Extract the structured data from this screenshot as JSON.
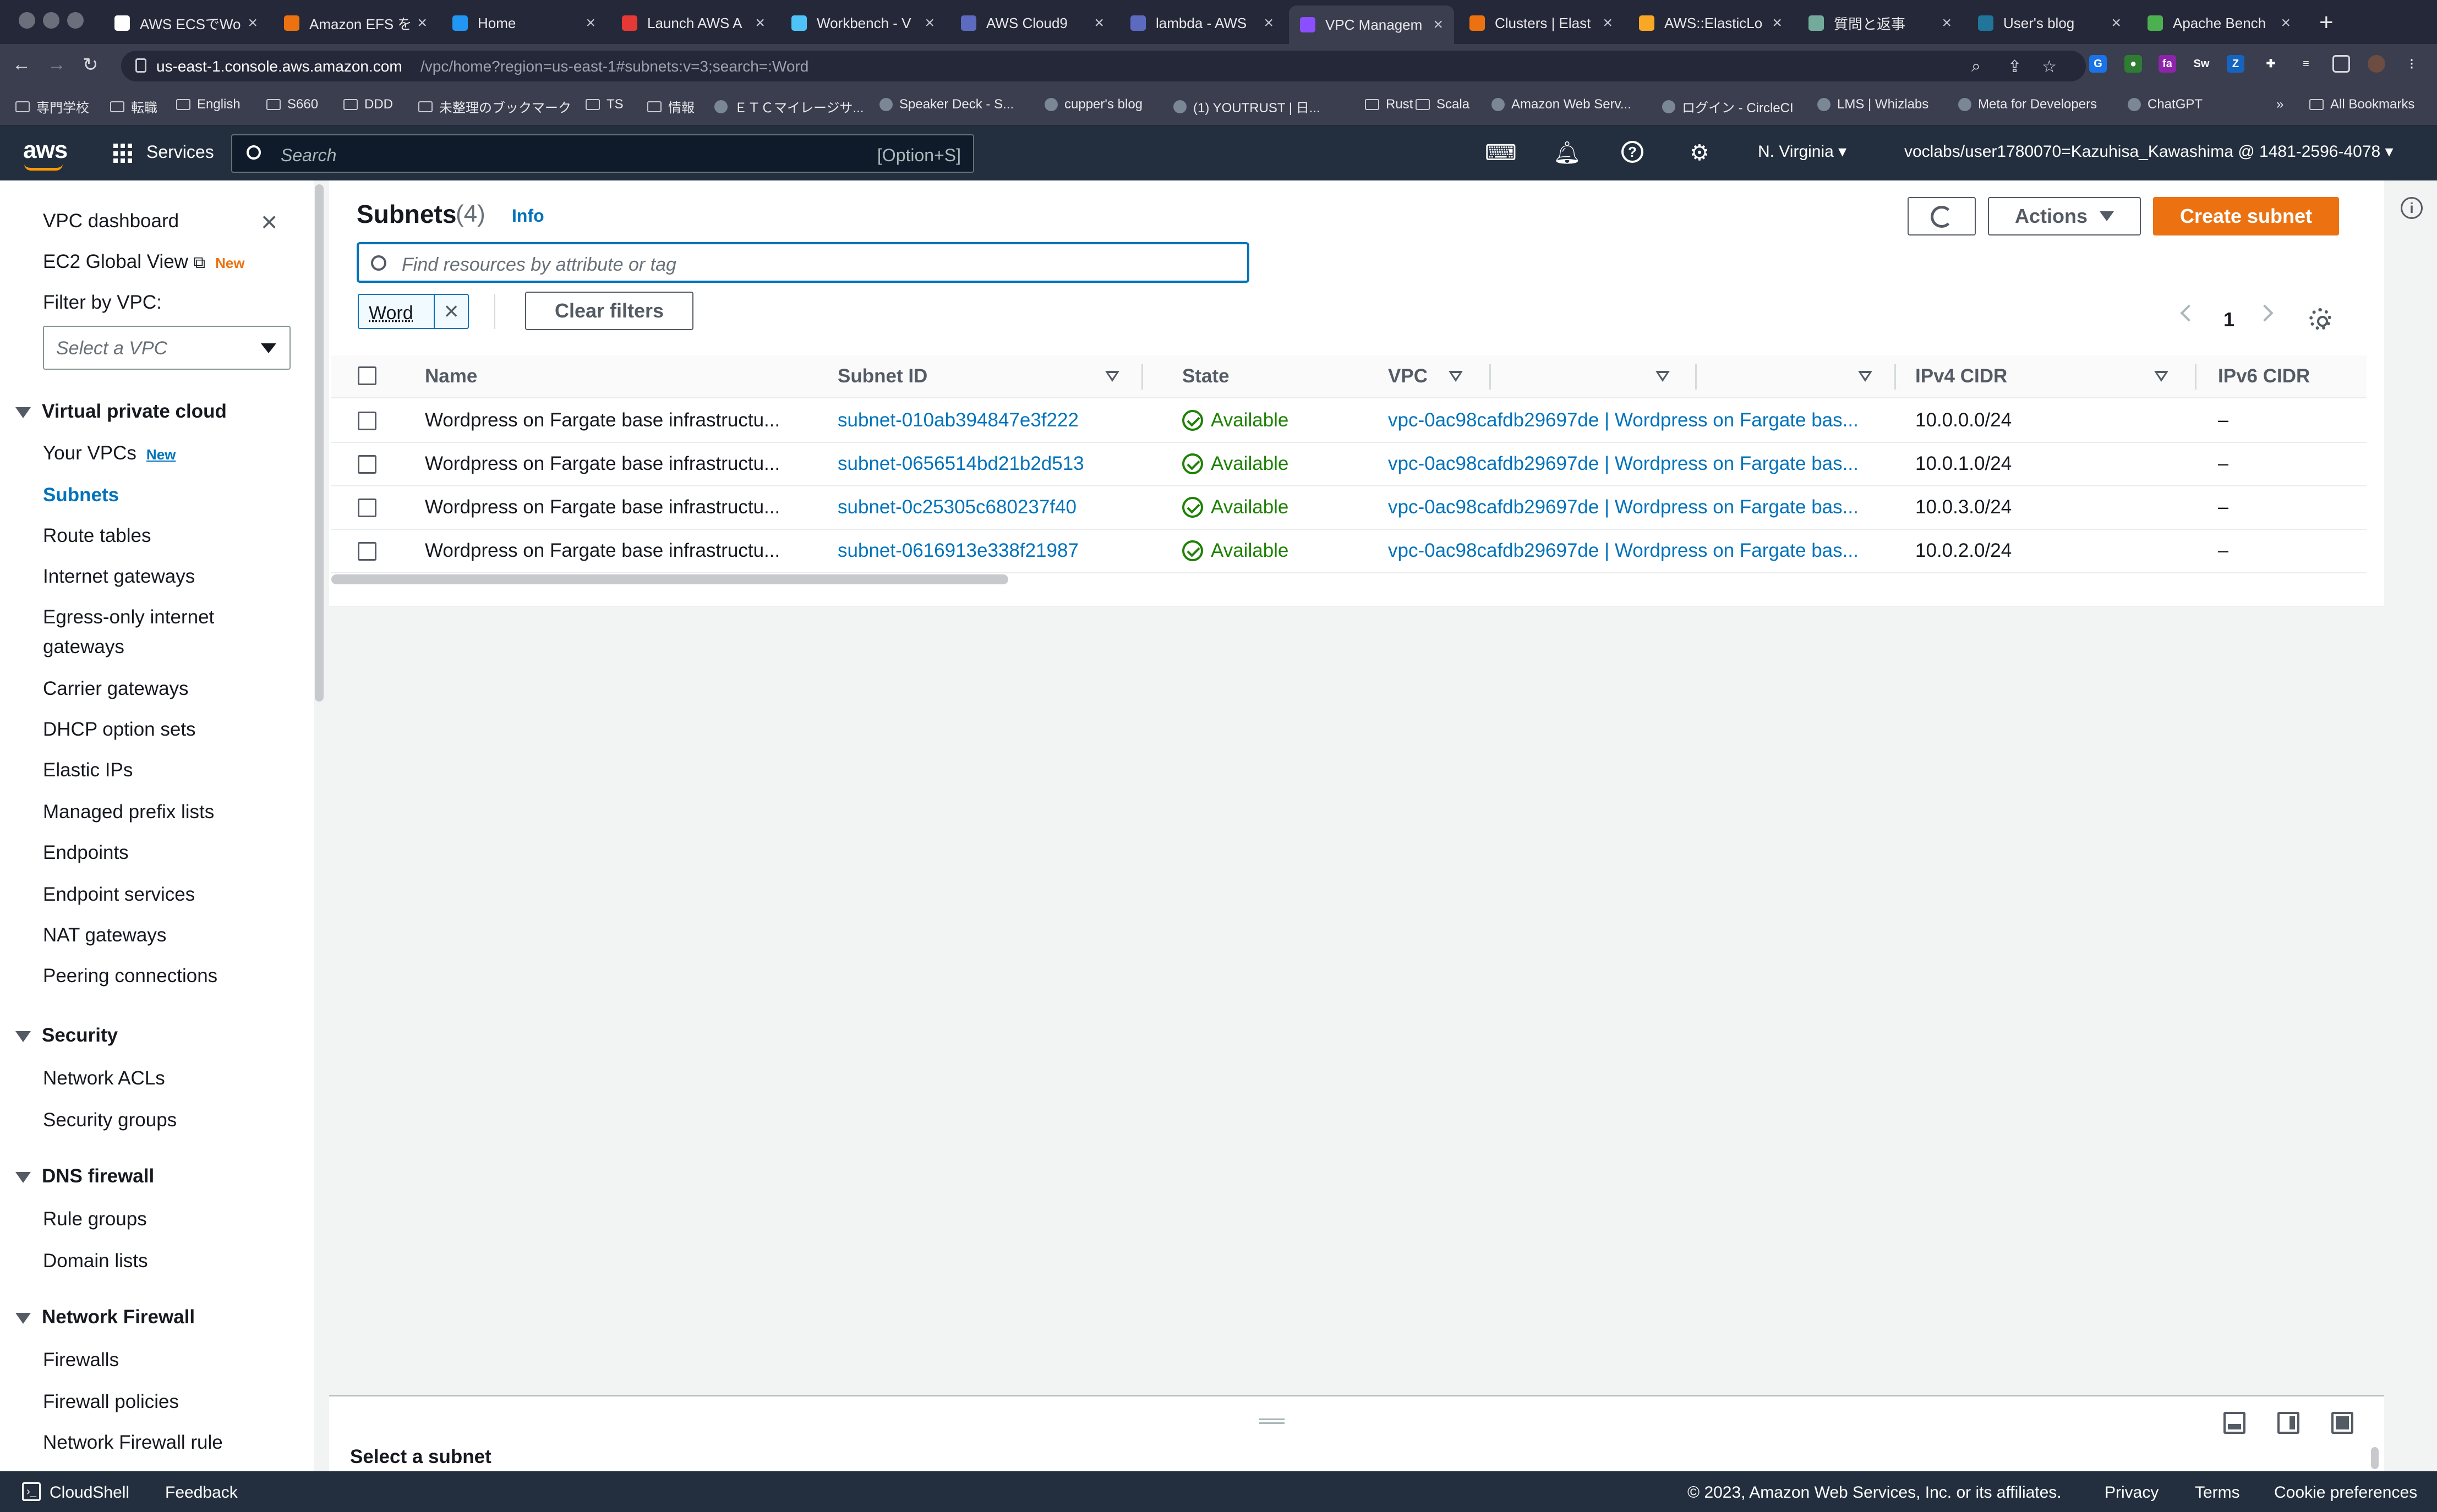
{
  "browser": {
    "tabs": [
      {
        "label": "AWS ECSでWo",
        "icon_color": "#ffffff"
      },
      {
        "label": "Amazon EFS を",
        "icon_color": "#ec7211"
      },
      {
        "label": "Home",
        "icon_color": "#2196f3"
      },
      {
        "label": "Launch AWS A",
        "icon_color": "#e53935"
      },
      {
        "label": "Workbench - V",
        "icon_color": "#4fc3f7"
      },
      {
        "label": "AWS Cloud9",
        "icon_color": "#5c6bc0"
      },
      {
        "label": "lambda - AWS",
        "icon_color": "#5c6bc0"
      },
      {
        "label": "VPC Managem",
        "icon_color": "#8c4fff"
      },
      {
        "label": "Clusters | Elast",
        "icon_color": "#ec7211"
      },
      {
        "label": "AWS::ElasticLo",
        "icon_color": "#f9a825"
      },
      {
        "label": "質問と返事",
        "icon_color": "#74aa9c"
      },
      {
        "label": "User's blog",
        "icon_color": "#21759b"
      },
      {
        "label": "Apache Bench",
        "icon_color": "#4caf50"
      }
    ],
    "url_host": "us-east-1.console.aws.amazon.com",
    "url_path": "/vpc/home?region=us-east-1#subnets:v=3;search=:Word",
    "bookmarks": [
      {
        "label": "専門学校",
        "icon": "folder-icon"
      },
      {
        "label": "転職",
        "icon": "folder-icon"
      },
      {
        "label": "English",
        "icon": "folder-icon"
      },
      {
        "label": "S660",
        "icon": "folder-icon"
      },
      {
        "label": "DDD",
        "icon": "folder-icon"
      },
      {
        "label": "未整理のブックマーク",
        "icon": "folder-icon"
      },
      {
        "label": "TS",
        "icon": "folder-icon"
      },
      {
        "label": "情報",
        "icon": "folder-icon"
      },
      {
        "label": "ＥＴＣマイレージサ...",
        "icon": "site-icon"
      },
      {
        "label": "Speaker Deck - S...",
        "icon": "site-icon"
      },
      {
        "label": "cupper's blog",
        "icon": "site-icon"
      },
      {
        "label": "(1) YOUTRUST | 日...",
        "icon": "site-icon"
      },
      {
        "label": "Rust",
        "icon": "folder-icon"
      },
      {
        "label": "Scala",
        "icon": "folder-icon"
      },
      {
        "label": "Amazon Web Serv...",
        "icon": "site-icon"
      },
      {
        "label": "ログイン - CircleCI",
        "icon": "site-icon"
      },
      {
        "label": "LMS | Whizlabs",
        "icon": "site-icon"
      },
      {
        "label": "Meta for Developers",
        "icon": "site-icon"
      },
      {
        "label": "ChatGPT",
        "icon": "site-icon"
      }
    ],
    "more_bookmarks": "»",
    "all_bookmarks": "All Bookmarks"
  },
  "aws_header": {
    "logo": "aws",
    "services": "Services",
    "search_placeholder": "Search",
    "search_shortcut": "[Option+S]",
    "region": "N. Virginia",
    "account": "voclabs/user1780070=Kazuhisa_Kawashima @ 1481-2596-4078"
  },
  "sidebar": {
    "top_items": [
      "VPC dashboard",
      "EC2 Global View"
    ],
    "new_badge": "New",
    "filter_label": "Filter by VPC:",
    "vpc_select_placeholder": "Select a VPC",
    "sections": [
      {
        "title": "Virtual private cloud",
        "items": [
          "Your VPCs",
          "Subnets",
          "Route tables",
          "Internet gateways",
          "Egress-only internet",
          "gateways",
          "Carrier gateways",
          "DHCP option sets",
          "Elastic IPs",
          "Managed prefix lists",
          "Endpoints",
          "Endpoint services",
          "NAT gateways",
          "Peering connections"
        ]
      },
      {
        "title": "Security",
        "items": [
          "Network ACLs",
          "Security groups"
        ]
      },
      {
        "title": "DNS firewall",
        "items": [
          "Rule groups",
          "Domain lists"
        ]
      },
      {
        "title": "Network Firewall",
        "items": [
          "Firewalls",
          "Firewall policies",
          "Network Firewall rule"
        ]
      }
    ]
  },
  "main": {
    "title": "Subnets",
    "count": "(4)",
    "info": "Info",
    "actions": "Actions",
    "create": "Create subnet",
    "filter_placeholder": "Find resources by attribute or tag",
    "filter_token": "Word",
    "clear_filters": "Clear filters",
    "page": "1",
    "columns": [
      "Name",
      "Subnet ID",
      "State",
      "VPC",
      "IPv4 CIDR",
      "IPv6 CIDR"
    ],
    "rows": [
      {
        "name": "Wordpress on Fargate base infrastructu...",
        "subnet_id": "subnet-010ab394847e3f222",
        "state": "Available",
        "vpc": "vpc-0ac98cafdb29697de | Wordpress on Fargate bas...",
        "ipv4": "10.0.0.0/24",
        "ipv6": "–"
      },
      {
        "name": "Wordpress on Fargate base infrastructu...",
        "subnet_id": "subnet-0656514bd21b2d513",
        "state": "Available",
        "vpc": "vpc-0ac98cafdb29697de | Wordpress on Fargate bas...",
        "ipv4": "10.0.1.0/24",
        "ipv6": "–"
      },
      {
        "name": "Wordpress on Fargate base infrastructu...",
        "subnet_id": "subnet-0c25305c680237f40",
        "state": "Available",
        "vpc": "vpc-0ac98cafdb29697de | Wordpress on Fargate bas...",
        "ipv4": "10.0.3.0/24",
        "ipv6": "–"
      },
      {
        "name": "Wordpress on Fargate base infrastructu...",
        "subnet_id": "subnet-0616913e338f21987",
        "state": "Available",
        "vpc": "vpc-0ac98cafdb29697de | Wordpress on Fargate bas...",
        "ipv4": "10.0.2.0/24",
        "ipv6": "–"
      }
    ],
    "split_title": "Select a subnet"
  },
  "footer": {
    "cloudshell": "CloudShell",
    "feedback": "Feedback",
    "copyright": "© 2023, Amazon Web Services, Inc. or its affiliates.",
    "privacy": "Privacy",
    "terms": "Terms",
    "cookies": "Cookie preferences"
  }
}
